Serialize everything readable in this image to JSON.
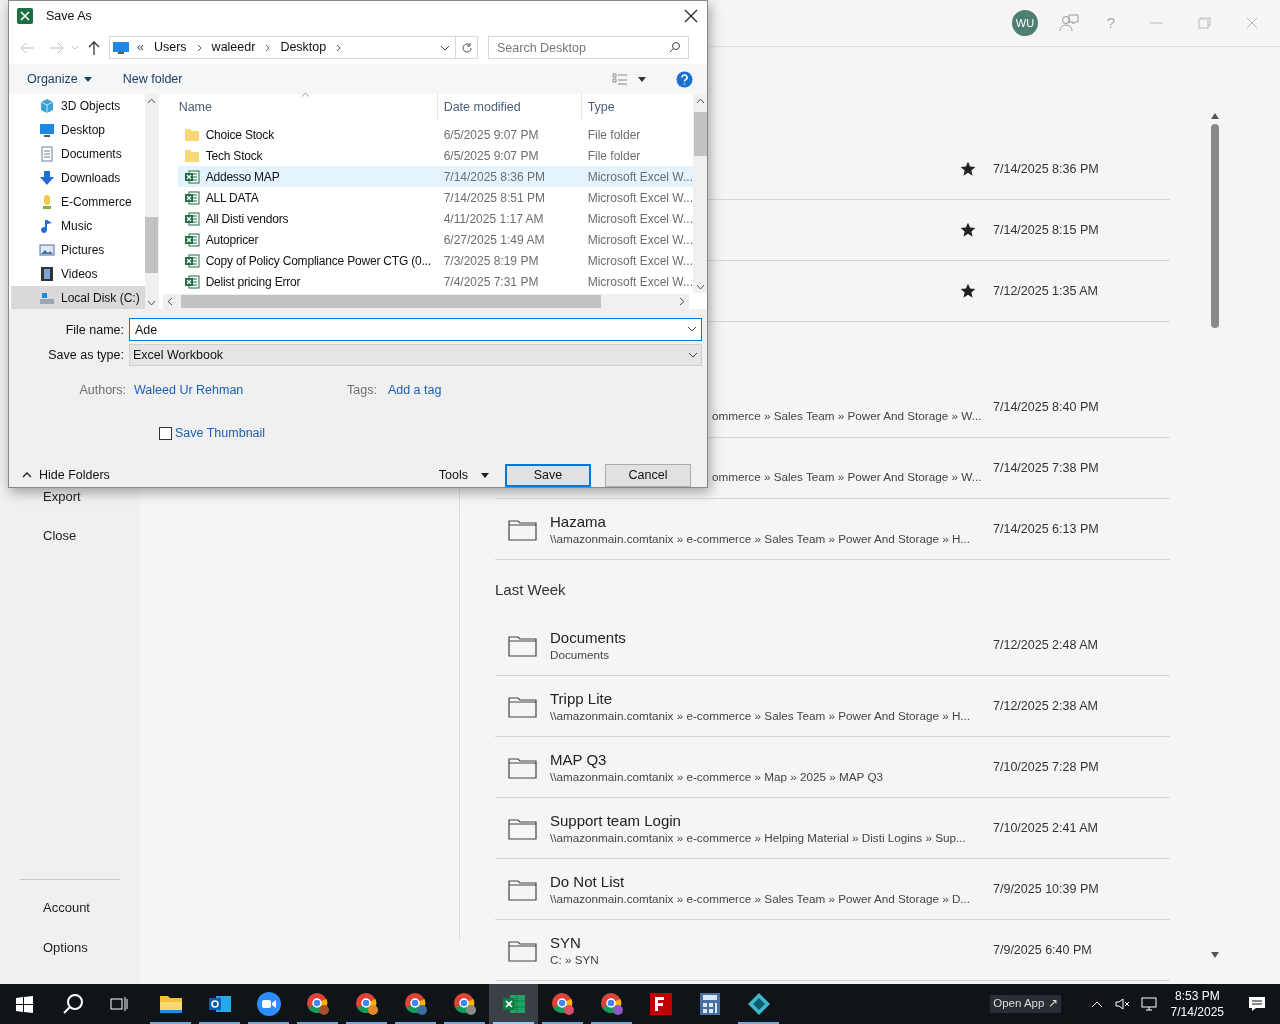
{
  "backstage": {
    "sidebar_top": [
      {
        "label": "Export"
      },
      {
        "label": "Close"
      }
    ],
    "sidebar_bottom": [
      {
        "label": "Account"
      },
      {
        "label": "Options"
      }
    ],
    "top_bar": {
      "avatar": "WU",
      "help": "?"
    },
    "pinned": [
      {
        "starred": true,
        "date": "7/14/2025 8:36 PM"
      },
      {
        "starred": true,
        "date": "7/14/2025 8:15 PM"
      },
      {
        "starred": true,
        "date": "7/12/2025 1:35 AM"
      }
    ],
    "groups": [
      {
        "items": [
          {
            "path": "ommerce » Sales Team » Power And Storage » W...",
            "date": "7/14/2025 8:40 PM"
          },
          {
            "path": "ommerce » Sales Team » Power And Storage » W...",
            "date": "7/14/2025 7:38 PM"
          },
          {
            "name": "Hazama",
            "path": "\\\\amazonmain.comtanix » e-commerce » Sales Team » Power And Storage » H...",
            "date": "7/14/2025 6:13 PM"
          }
        ]
      },
      {
        "heading": "Last Week",
        "items": [
          {
            "name": "Documents",
            "path": "Documents",
            "date": "7/12/2025 2:48 AM"
          },
          {
            "name": "Tripp Lite",
            "path": "\\\\amazonmain.comtanix » e-commerce » Sales Team » Power And Storage » H...",
            "date": "7/12/2025 2:38 AM"
          },
          {
            "name": "MAP Q3",
            "path": "\\\\amazonmain.comtanix » e-commerce » Map » 2025 » MAP Q3",
            "date": "7/10/2025 7:28 PM"
          },
          {
            "name": "Support team Login",
            "path": "\\\\amazonmain.comtanix » e-commerce » Helping Material » Disti Logins » Sup...",
            "date": "7/10/2025 2:41 AM"
          },
          {
            "name": "Do Not List",
            "path": "\\\\amazonmain.comtanix » e-commerce » Sales Team » Power And Storage » D...",
            "date": "7/9/2025 10:39 PM"
          },
          {
            "name": "SYN",
            "path": "C: » SYN",
            "date": "7/9/2025 6:40 PM"
          }
        ]
      }
    ]
  },
  "dialog": {
    "title": "Save As",
    "address": {
      "overflow": "«",
      "crumbs": [
        "Users",
        "waleedr",
        "Desktop"
      ]
    },
    "search": {
      "placeholder": "Search Desktop"
    },
    "toolbar": {
      "organize": "Organize",
      "new_folder": "New folder"
    },
    "nav": [
      {
        "label": "3D Objects",
        "kind": "cube",
        "selected": false
      },
      {
        "label": "Desktop",
        "kind": "desktop",
        "selected": false
      },
      {
        "label": "Documents",
        "kind": "document",
        "selected": false
      },
      {
        "label": "Downloads",
        "kind": "download",
        "selected": false
      },
      {
        "label": "E-Commerce",
        "kind": "user",
        "selected": false
      },
      {
        "label": "Music",
        "kind": "music",
        "selected": false
      },
      {
        "label": "Pictures",
        "kind": "picture",
        "selected": false
      },
      {
        "label": "Videos",
        "kind": "film",
        "selected": false
      },
      {
        "label": "Local Disk (C:)",
        "kind": "disk",
        "selected": true
      }
    ],
    "columns": [
      "Name",
      "Date modified",
      "Type"
    ],
    "rows": [
      {
        "name": "Choice Stock",
        "date": "6/5/2025 9:07 PM",
        "type": "File folder",
        "kind": "folder",
        "selected": false
      },
      {
        "name": "Tech Stock",
        "date": "6/5/2025 9:07 PM",
        "type": "File folder",
        "kind": "folder",
        "selected": false
      },
      {
        "name": "Addesso MAP",
        "date": "7/14/2025 8:36 PM",
        "type": "Microsoft Excel W...",
        "kind": "excel",
        "selected": true
      },
      {
        "name": "ALL DATA",
        "date": "7/14/2025 8:51 PM",
        "type": "Microsoft Excel W...",
        "kind": "excel",
        "selected": false
      },
      {
        "name": "All Disti vendors",
        "date": "4/11/2025 1:17 AM",
        "type": "Microsoft Excel W...",
        "kind": "excel",
        "selected": false
      },
      {
        "name": "Autopricer",
        "date": "6/27/2025 1:49 AM",
        "type": "Microsoft Excel W...",
        "kind": "excel",
        "selected": false
      },
      {
        "name": "Copy of Policy Compliance Power CTG (0...",
        "date": "7/3/2025 8:19 PM",
        "type": "Microsoft Excel W...",
        "kind": "excel",
        "selected": false
      },
      {
        "name": "Delist pricing Error",
        "date": "7/4/2025 7:31 PM",
        "type": "Microsoft Excel W...",
        "kind": "excel",
        "selected": false
      }
    ],
    "file_name": {
      "label": "File name:",
      "value": "Ade"
    },
    "save_type": {
      "label": "Save as type:",
      "value": "Excel Workbook"
    },
    "authors": {
      "label": "Authors:",
      "value": "Waleed Ur Rehman"
    },
    "tags": {
      "label": "Tags:",
      "value": "Add a tag"
    },
    "thumbnail": {
      "label": "Save Thumbnail",
      "checked": false
    },
    "hide_folders": "Hide Folders",
    "tools": "Tools",
    "save": "Save",
    "cancel": "Cancel"
  },
  "taskbar": {
    "apps": [
      {
        "kind": "folder",
        "open": true,
        "active": false
      },
      {
        "kind": "mail",
        "open": true,
        "active": false
      },
      {
        "kind": "video",
        "open": true,
        "active": false
      },
      {
        "kind": "browser",
        "open": true,
        "active": false,
        "color": "#a0522d"
      },
      {
        "kind": "browser",
        "open": true,
        "active": false,
        "color": "#e08a2e"
      },
      {
        "kind": "browser",
        "open": true,
        "active": false,
        "color": "#3a6ea5"
      },
      {
        "kind": "browser",
        "open": true,
        "active": false,
        "color": "#8a8a8a"
      },
      {
        "kind": "sheet",
        "open": true,
        "active": true
      },
      {
        "kind": "browser",
        "open": true,
        "active": false,
        "color": "#d94c6a"
      },
      {
        "kind": "browser",
        "open": true,
        "active": false,
        "color": "#8e5ac8"
      },
      {
        "kind": "ftp",
        "open": false,
        "active": false
      },
      {
        "kind": "calc",
        "open": false,
        "active": false
      },
      {
        "kind": "diamond",
        "open": true,
        "active": false
      }
    ],
    "open_app": "Open App ↗",
    "time": "8:53 PM",
    "date": "7/14/2025"
  }
}
